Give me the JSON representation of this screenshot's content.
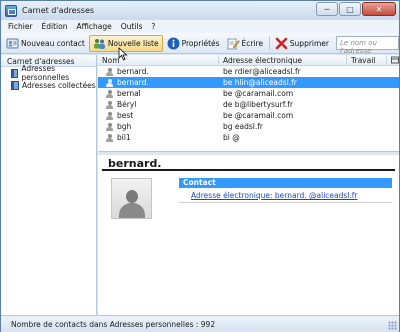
{
  "window": {
    "title": "Carnet d'adresses",
    "controls": {
      "minimize": "─",
      "maximize": "□",
      "close": "✕"
    }
  },
  "menu": [
    {
      "key": "fichier",
      "label": "Fichier"
    },
    {
      "key": "edition",
      "label": "Édition"
    },
    {
      "key": "affichage",
      "label": "Affichage"
    },
    {
      "key": "outils",
      "label": "Outils"
    },
    {
      "key": "aide",
      "label": "?"
    }
  ],
  "toolbar": {
    "new_contact": {
      "label": "Nouveau contact",
      "icon": "contact-card-icon"
    },
    "new_list": {
      "label": "Nouvelle liste",
      "icon": "people-group-icon"
    },
    "properties": {
      "label": "Propriétés",
      "icon": "info-icon"
    },
    "write": {
      "label": "Écrire",
      "icon": "pencil-page-icon"
    },
    "delete": {
      "label": "Supprimer",
      "icon": "red-x-icon"
    },
    "search_placeholder": "Le nom ou l'adresse"
  },
  "left_pane": {
    "header": "Carnet d'adresses",
    "books": [
      {
        "label": "Adresses personnelles",
        "icon": "address-book-icon"
      },
      {
        "label": "Adresses collectées",
        "icon": "address-book-icon"
      }
    ]
  },
  "contact_list": {
    "columns": {
      "name": "Nom",
      "email": "Adresse électronique",
      "work": "Travail"
    },
    "rows": [
      {
        "name": "bernard.",
        "email": "be          rdier@aliceadsl.fr",
        "work": "",
        "selected": false
      },
      {
        "name": "bernard.",
        "email": "be          hlin@aliceadsl.fr",
        "work": "",
        "selected": true
      },
      {
        "name": "bernal",
        "email": "be          @caramail.com",
        "work": "",
        "selected": false
      },
      {
        "name": "Béryl",
        "email": "de          b@libertysurf.fr",
        "work": "",
        "selected": false
      },
      {
        "name": "best",
        "email": "be          @caramail.com",
        "work": "",
        "selected": false
      },
      {
        "name": "bgh",
        "email": "bg          eadsl.fr",
        "work": "",
        "selected": false
      },
      {
        "name": "bil1",
        "email": "bi          @",
        "work": "",
        "selected": false
      }
    ]
  },
  "detail": {
    "name": "bernard.",
    "section_title": "Contact",
    "email_label": "Adresse électronique:",
    "email_value": "bernard.          @aliceadsl.fr"
  },
  "status": {
    "text": "Nombre de contacts dans Adresses personnelles : 992"
  },
  "colors": {
    "selection": "#3399ff",
    "link": "#1548c8",
    "window_frame": "#dbe6f3"
  }
}
